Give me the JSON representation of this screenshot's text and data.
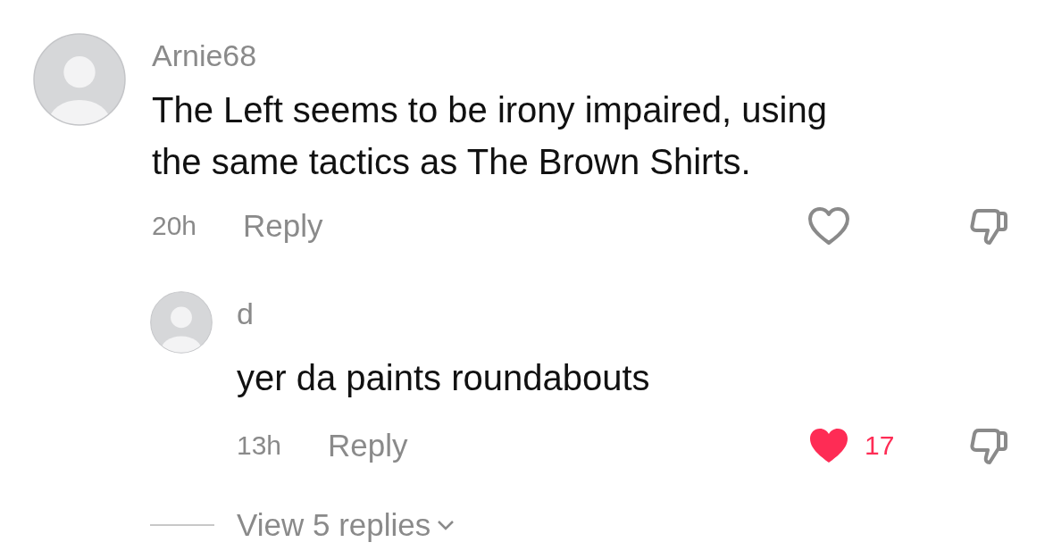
{
  "comment": {
    "username": "Arnie68",
    "text": "The Left seems to be irony impaired, using the same tactics as The Brown Shirts.",
    "time": "20h",
    "reply_label": "Reply",
    "liked": false,
    "replies": [
      {
        "username": "d",
        "text": "yer da paints roundabouts",
        "time": "13h",
        "reply_label": "Reply",
        "liked": true,
        "like_count": "17"
      }
    ],
    "view_replies": "View 5 replies"
  }
}
